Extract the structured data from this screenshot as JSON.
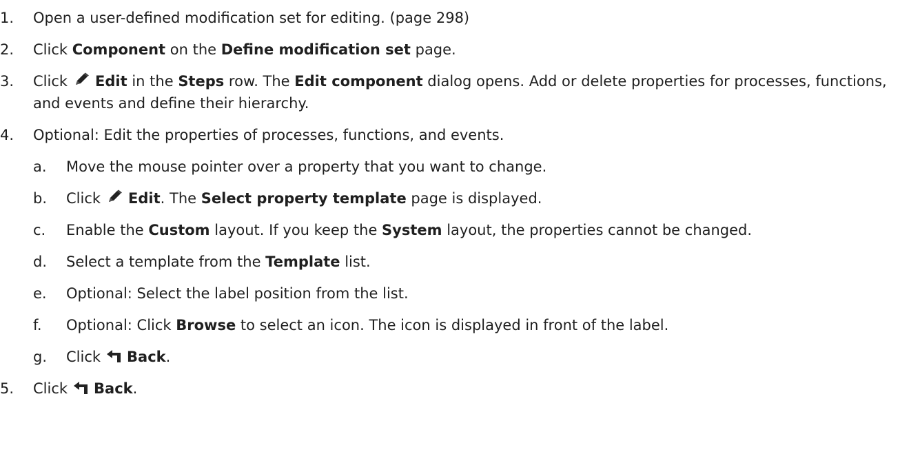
{
  "steps": [
    {
      "num": "1.",
      "parts": [
        {
          "t": "Open a user-defined modification set for editing. (page 298)"
        }
      ]
    },
    {
      "num": "2.",
      "parts": [
        {
          "t": "Click "
        },
        {
          "b": "Component"
        },
        {
          "t": " on the "
        },
        {
          "b": "Define modification set"
        },
        {
          "t": " page."
        }
      ]
    },
    {
      "num": "3.",
      "parts": [
        {
          "t": "Click"
        },
        {
          "icon": "pencil-icon"
        },
        {
          "b": "Edit"
        },
        {
          "t": " in the "
        },
        {
          "b": "Steps"
        },
        {
          "t": " row. The "
        },
        {
          "b": "Edit component"
        },
        {
          "t": " dialog opens. Add or delete properties for processes, functions, and events and define their hierarchy."
        }
      ]
    },
    {
      "num": "4.",
      "parts": [
        {
          "t": "Optional: Edit the properties of processes, functions, and events."
        }
      ],
      "substeps": [
        {
          "letter": "a.",
          "parts": [
            {
              "t": "Move the mouse pointer over a property that you want to change."
            }
          ]
        },
        {
          "letter": "b.",
          "parts": [
            {
              "t": "Click"
            },
            {
              "icon": "pencil-icon"
            },
            {
              "b": "Edit"
            },
            {
              "t": ". The "
            },
            {
              "b": "Select property template"
            },
            {
              "t": " page is displayed."
            }
          ]
        },
        {
          "letter": "c.",
          "parts": [
            {
              "t": "Enable the "
            },
            {
              "b": "Custom"
            },
            {
              "t": " layout. If you keep the "
            },
            {
              "b": "System"
            },
            {
              "t": " layout, the properties cannot be changed."
            }
          ]
        },
        {
          "letter": "d.",
          "parts": [
            {
              "t": "Select a template from the "
            },
            {
              "b": "Template"
            },
            {
              "t": " list."
            }
          ]
        },
        {
          "letter": "e.",
          "parts": [
            {
              "t": "Optional: Select the label position from the list."
            }
          ]
        },
        {
          "letter": "f.",
          "parts": [
            {
              "t": "Optional: Click "
            },
            {
              "b": "Browse"
            },
            {
              "t": " to select an icon. The icon is displayed in front of the label."
            }
          ]
        },
        {
          "letter": "g.",
          "parts": [
            {
              "t": "Click"
            },
            {
              "icon": "back-arrow-icon"
            },
            {
              "b": "Back"
            },
            {
              "t": "."
            }
          ]
        }
      ]
    },
    {
      "num": "5.",
      "parts": [
        {
          "t": "Click"
        },
        {
          "icon": "back-arrow-icon"
        },
        {
          "b": "Back"
        },
        {
          "t": "."
        }
      ]
    }
  ]
}
